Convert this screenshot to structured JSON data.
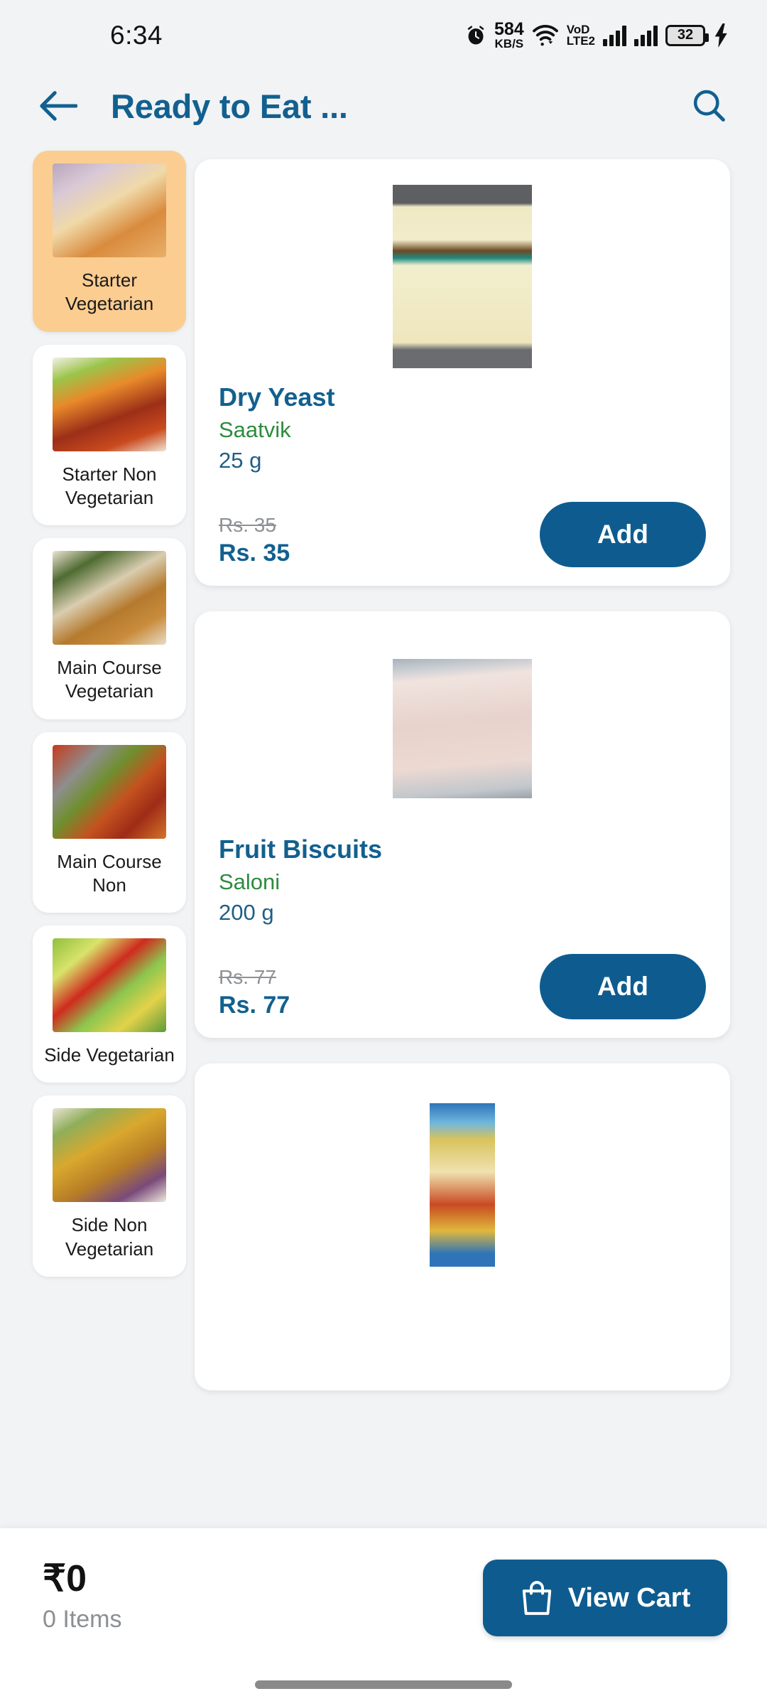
{
  "statusbar": {
    "time": "6:34",
    "net_speed_value": "584",
    "net_speed_unit": "KB/S",
    "volte_line1": "VoD",
    "volte_line2": "LTE2",
    "battery": "32",
    "icons": [
      "alarm-icon",
      "wifi-icon",
      "signal-icon",
      "battery-icon",
      "charging-icon"
    ]
  },
  "appbar": {
    "back_icon": "arrow-left-icon",
    "title": "Ready to Eat ...",
    "search_icon": "search-icon",
    "accent_color": "#12608f"
  },
  "sidebar": {
    "items": [
      {
        "label": "Starter Vegetarian",
        "active": true
      },
      {
        "label": "Starter Non Vegetarian",
        "active": false
      },
      {
        "label": "Main Course Vegetarian",
        "active": false
      },
      {
        "label": "Main Course Non",
        "active": false
      },
      {
        "label": "Side Vegetarian",
        "active": false
      },
      {
        "label": "Side Non Vegetarian",
        "active": false
      }
    ],
    "active_bg": "#fbcd91"
  },
  "products": [
    {
      "name": "Dry Yeast",
      "brand": "Saatvik",
      "quantity": "25 g",
      "mrp": "Rs. 35",
      "price": "Rs. 35",
      "add_label": "Add"
    },
    {
      "name": "Fruit Biscuits",
      "brand": "Saloni",
      "quantity": "200 g",
      "mrp": "Rs. 77",
      "price": "Rs. 77",
      "add_label": "Add"
    },
    {
      "name": "",
      "brand": "",
      "quantity": "",
      "mrp": "",
      "price": "",
      "add_label": ""
    }
  ],
  "cartbar": {
    "total": "₹0",
    "items": "0 Items",
    "view_cart_label": "View Cart",
    "bag_icon": "shopping-bag-icon",
    "button_color": "#0e5c8f"
  }
}
